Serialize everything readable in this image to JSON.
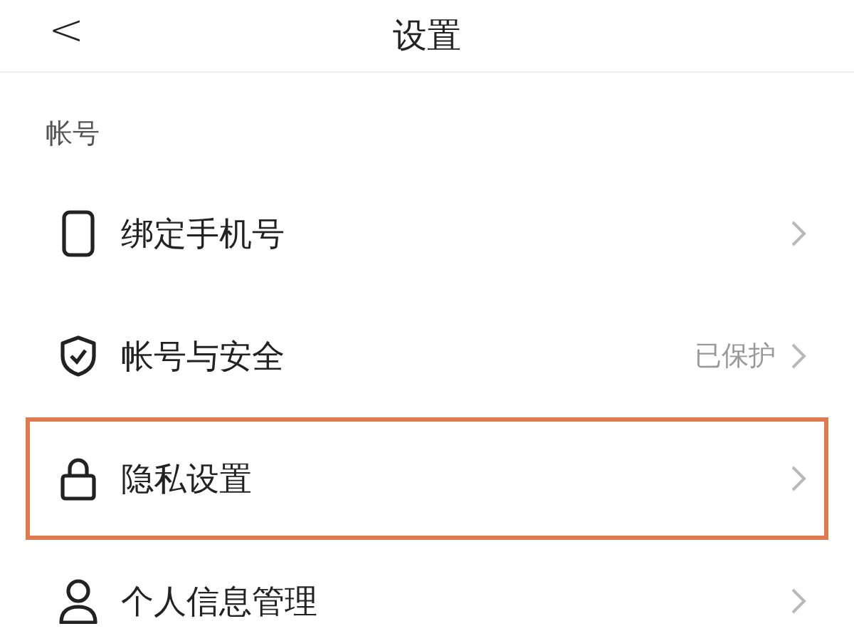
{
  "header": {
    "back": "<",
    "title": "设置"
  },
  "section": {
    "label": "帐号"
  },
  "items": [
    {
      "kind": "phone",
      "label": "绑定手机号",
      "highlighted": false
    },
    {
      "kind": "shield",
      "label": "帐号与安全",
      "value": "已保护",
      "highlighted": false
    },
    {
      "kind": "lock",
      "label": "隐私设置",
      "highlighted": true
    },
    {
      "kind": "person",
      "label": "个人信息管理",
      "highlighted": false
    }
  ]
}
